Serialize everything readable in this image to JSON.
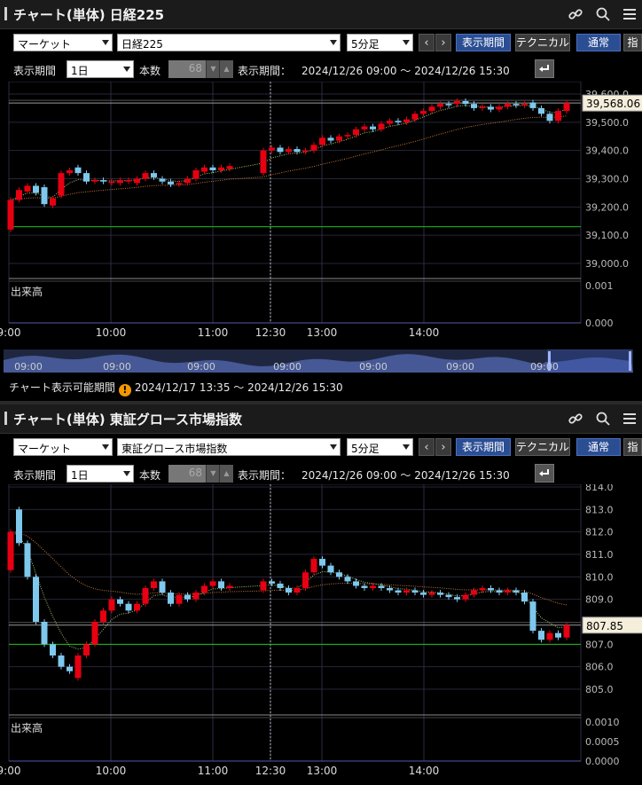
{
  "panels": [
    {
      "title": "チャート(単体) 日経225",
      "market": "マーケット",
      "symbol": "日経225",
      "interval": "5分足",
      "prev_label": "‹",
      "next_label": "›",
      "display_period_btn": "表示期間",
      "technical_btn": "テクニカル",
      "normal_btn": "通常",
      "extra_btn": "指",
      "period_label": "表示期間",
      "period_value": "1日",
      "count_label": "本数",
      "count_value": "68",
      "range_label": "表示期間：",
      "range_value": "2024/12/26 09:00 ～ 2024/12/26 15:30",
      "volume_label": "出来高",
      "current_price": "39,568.06",
      "price_ticks": [
        "39,600.0",
        "39,500.0",
        "39,400.0",
        "39,300.0",
        "39,200.0",
        "39,100.0",
        "39,000.0"
      ],
      "volume_ticks": [
        "0.001",
        "0.000"
      ],
      "time_ticks": [
        "9:00",
        "10:00",
        "11:00",
        "12:30",
        "13:00",
        "14:00"
      ],
      "navigator_ticks": [
        "09:00",
        "09:00",
        "09:00",
        "09:00",
        "09:00",
        "09:00",
        "09:00"
      ],
      "available_label": "チャート表示可能期間",
      "available_value": "2024/12/17 13:35 ～ 2024/12/26 15:30"
    },
    {
      "title": "チャート(単体) 東証グロース市場指数",
      "market": "マーケット",
      "symbol": "東証グロース市場指数",
      "interval": "5分足",
      "prev_label": "‹",
      "next_label": "›",
      "display_period_btn": "表示期間",
      "technical_btn": "テクニカル",
      "normal_btn": "通常",
      "extra_btn": "指",
      "period_label": "表示期間",
      "period_value": "1日",
      "count_label": "本数",
      "count_value": "68",
      "range_label": "表示期間：",
      "range_value": "2024/12/26 09:00 ～ 2024/12/26 15:30",
      "volume_label": "出来高",
      "current_price": "807.85",
      "price_ticks": [
        "814.0",
        "813.0",
        "812.0",
        "811.0",
        "810.0",
        "809.0",
        "807.0",
        "806.0",
        "805.0"
      ],
      "volume_ticks": [
        "0.0010",
        "0.0005",
        "0.0000"
      ],
      "time_ticks": [
        "9:00",
        "10:00",
        "11:00",
        "12:30",
        "13:00",
        "14:00"
      ]
    }
  ],
  "colors": {
    "up": "#e60012",
    "down": "#7ec8ee",
    "ma_short": "#a8c86a",
    "ma_long": "#c8783c",
    "support_line": "#19c219",
    "accent": "#2b4e93"
  },
  "chart_data": [
    {
      "type": "candlestick",
      "title": "日経225",
      "x_range": [
        "09:00",
        "15:30"
      ],
      "ylim": [
        39000,
        39600
      ],
      "candles": [
        {
          "t": "09:00",
          "o": 39120,
          "c": 39225
        },
        {
          "t": "09:05",
          "o": 39225,
          "c": 39260
        },
        {
          "t": "09:10",
          "o": 39255,
          "c": 39275
        },
        {
          "t": "09:15",
          "o": 39275,
          "c": 39250
        },
        {
          "t": "09:20",
          "o": 39270,
          "c": 39210
        },
        {
          "t": "09:25",
          "o": 39205,
          "c": 39230
        },
        {
          "t": "09:30",
          "o": 39240,
          "c": 39320
        },
        {
          "t": "09:35",
          "o": 39320,
          "c": 39330
        },
        {
          "t": "09:40",
          "o": 39340,
          "c": 39320
        },
        {
          "t": "09:45",
          "o": 39320,
          "c": 39290
        },
        {
          "t": "09:50",
          "o": 39290,
          "c": 39295
        },
        {
          "t": "09:55",
          "o": 39295,
          "c": 39290
        },
        {
          "t": "10:00",
          "o": 39285,
          "c": 39290
        },
        {
          "t": "10:05",
          "o": 39285,
          "c": 39295
        },
        {
          "t": "10:10",
          "o": 39290,
          "c": 39295
        },
        {
          "t": "10:15",
          "o": 39285,
          "c": 39300
        },
        {
          "t": "10:20",
          "o": 39300,
          "c": 39320
        },
        {
          "t": "10:25",
          "o": 39320,
          "c": 39305
        },
        {
          "t": "10:30",
          "o": 39300,
          "c": 39290
        },
        {
          "t": "10:35",
          "o": 39290,
          "c": 39280
        },
        {
          "t": "10:40",
          "o": 39280,
          "c": 39285
        },
        {
          "t": "10:45",
          "o": 39285,
          "c": 39300
        },
        {
          "t": "10:50",
          "o": 39300,
          "c": 39330
        },
        {
          "t": "10:55",
          "o": 39325,
          "c": 39340
        },
        {
          "t": "11:00",
          "o": 39340,
          "c": 39330
        },
        {
          "t": "11:05",
          "o": 39330,
          "c": 39340
        },
        {
          "t": "11:10",
          "o": 39335,
          "c": 39345
        },
        {
          "t": "12:30",
          "o": 39320,
          "c": 39400
        },
        {
          "t": "12:35",
          "o": 39400,
          "c": 39410
        },
        {
          "t": "12:40",
          "o": 39410,
          "c": 39395
        },
        {
          "t": "12:45",
          "o": 39395,
          "c": 39405
        },
        {
          "t": "12:50",
          "o": 39405,
          "c": 39395
        },
        {
          "t": "12:55",
          "o": 39395,
          "c": 39400
        },
        {
          "t": "13:00",
          "o": 39400,
          "c": 39420
        },
        {
          "t": "13:05",
          "o": 39420,
          "c": 39445
        },
        {
          "t": "13:10",
          "o": 39445,
          "c": 39435
        },
        {
          "t": "13:15",
          "o": 39435,
          "c": 39450
        },
        {
          "t": "13:20",
          "o": 39450,
          "c": 39455
        },
        {
          "t": "13:25",
          "o": 39455,
          "c": 39475
        },
        {
          "t": "13:30",
          "o": 39475,
          "c": 39485
        },
        {
          "t": "13:35",
          "o": 39485,
          "c": 39475
        },
        {
          "t": "13:40",
          "o": 39475,
          "c": 39495
        },
        {
          "t": "13:45",
          "o": 39495,
          "c": 39505
        },
        {
          "t": "13:50",
          "o": 39505,
          "c": 39500
        },
        {
          "t": "13:55",
          "o": 39500,
          "c": 39510
        },
        {
          "t": "14:00",
          "o": 39510,
          "c": 39530
        },
        {
          "t": "14:05",
          "o": 39530,
          "c": 39540
        },
        {
          "t": "14:10",
          "o": 39540,
          "c": 39555
        },
        {
          "t": "14:15",
          "o": 39555,
          "c": 39565
        },
        {
          "t": "14:20",
          "o": 39565,
          "c": 39560
        },
        {
          "t": "14:25",
          "o": 39565,
          "c": 39575
        },
        {
          "t": "14:30",
          "o": 39575,
          "c": 39565
        },
        {
          "t": "14:35",
          "o": 39565,
          "c": 39550
        },
        {
          "t": "14:40",
          "o": 39550,
          "c": 39555
        },
        {
          "t": "14:45",
          "o": 39555,
          "c": 39545
        },
        {
          "t": "14:50",
          "o": 39545,
          "c": 39555
        },
        {
          "t": "14:55",
          "o": 39555,
          "c": 39565
        },
        {
          "t": "15:00",
          "o": 39565,
          "c": 39560
        },
        {
          "t": "15:05",
          "o": 39560,
          "c": 39565
        },
        {
          "t": "15:10",
          "o": 39570,
          "c": 39550
        },
        {
          "t": "15:15",
          "o": 39550,
          "c": 39530
        },
        {
          "t": "15:20",
          "o": 39530,
          "c": 39505
        },
        {
          "t": "15:25",
          "o": 39505,
          "c": 39540
        },
        {
          "t": "15:30",
          "o": 39540,
          "c": 39568
        }
      ],
      "support_line": 39130
    },
    {
      "type": "candlestick",
      "title": "東証グロース市場指数",
      "x_range": [
        "09:00",
        "15:30"
      ],
      "ylim": [
        804.5,
        814.0
      ],
      "candles": [
        {
          "t": "09:00",
          "o": 810.3,
          "c": 812.0
        },
        {
          "t": "09:05",
          "o": 813.0,
          "c": 811.5
        },
        {
          "t": "09:10",
          "o": 811.5,
          "c": 810.0
        },
        {
          "t": "09:15",
          "o": 810.0,
          "c": 808.0
        },
        {
          "t": "09:20",
          "o": 808.0,
          "c": 807.0
        },
        {
          "t": "09:25",
          "o": 807.0,
          "c": 806.5
        },
        {
          "t": "09:30",
          "o": 806.5,
          "c": 806.0
        },
        {
          "t": "09:35",
          "o": 806.0,
          "c": 805.8
        },
        {
          "t": "09:40",
          "o": 805.5,
          "c": 806.5
        },
        {
          "t": "09:45",
          "o": 806.5,
          "c": 807.0
        },
        {
          "t": "09:50",
          "o": 807.0,
          "c": 808.0
        },
        {
          "t": "09:55",
          "o": 808.0,
          "c": 808.5
        },
        {
          "t": "10:00",
          "o": 808.5,
          "c": 809.0
        },
        {
          "t": "10:05",
          "o": 809.0,
          "c": 808.8
        },
        {
          "t": "10:10",
          "o": 808.8,
          "c": 808.5
        },
        {
          "t": "10:15",
          "o": 808.5,
          "c": 808.8
        },
        {
          "t": "10:20",
          "o": 808.8,
          "c": 809.5
        },
        {
          "t": "10:25",
          "o": 809.5,
          "c": 809.8
        },
        {
          "t": "10:30",
          "o": 809.8,
          "c": 809.3
        },
        {
          "t": "10:35",
          "o": 809.3,
          "c": 808.8
        },
        {
          "t": "10:40",
          "o": 808.8,
          "c": 809.2
        },
        {
          "t": "10:45",
          "o": 809.2,
          "c": 809.0
        },
        {
          "t": "10:50",
          "o": 809.0,
          "c": 809.3
        },
        {
          "t": "10:55",
          "o": 809.3,
          "c": 809.6
        },
        {
          "t": "11:00",
          "o": 809.6,
          "c": 809.8
        },
        {
          "t": "11:05",
          "o": 809.8,
          "c": 809.5
        },
        {
          "t": "11:10",
          "o": 809.5,
          "c": 809.6
        },
        {
          "t": "12:30",
          "o": 809.4,
          "c": 809.8
        },
        {
          "t": "12:35",
          "o": 809.8,
          "c": 809.7
        },
        {
          "t": "12:40",
          "o": 809.7,
          "c": 809.5
        },
        {
          "t": "12:45",
          "o": 809.5,
          "c": 809.3
        },
        {
          "t": "12:50",
          "o": 809.3,
          "c": 809.5
        },
        {
          "t": "12:55",
          "o": 809.5,
          "c": 810.2
        },
        {
          "t": "13:00",
          "o": 810.2,
          "c": 810.8
        },
        {
          "t": "13:05",
          "o": 810.8,
          "c": 810.5
        },
        {
          "t": "13:10",
          "o": 810.5,
          "c": 810.2
        },
        {
          "t": "13:15",
          "o": 810.2,
          "c": 810.0
        },
        {
          "t": "13:20",
          "o": 810.0,
          "c": 809.8
        },
        {
          "t": "13:25",
          "o": 809.8,
          "c": 809.6
        },
        {
          "t": "13:30",
          "o": 809.6,
          "c": 809.5
        },
        {
          "t": "13:35",
          "o": 809.5,
          "c": 809.6
        },
        {
          "t": "13:40",
          "o": 809.6,
          "c": 809.5
        },
        {
          "t": "13:45",
          "o": 809.5,
          "c": 809.4
        },
        {
          "t": "13:50",
          "o": 809.4,
          "c": 809.3
        },
        {
          "t": "13:55",
          "o": 809.3,
          "c": 809.4
        },
        {
          "t": "14:00",
          "o": 809.4,
          "c": 809.3
        },
        {
          "t": "14:05",
          "o": 809.3,
          "c": 809.2
        },
        {
          "t": "14:10",
          "o": 809.2,
          "c": 809.3
        },
        {
          "t": "14:15",
          "o": 809.3,
          "c": 809.2
        },
        {
          "t": "14:20",
          "o": 809.2,
          "c": 809.1
        },
        {
          "t": "14:25",
          "o": 809.1,
          "c": 809.0
        },
        {
          "t": "14:30",
          "o": 809.0,
          "c": 809.2
        },
        {
          "t": "14:35",
          "o": 809.2,
          "c": 809.4
        },
        {
          "t": "14:40",
          "o": 809.4,
          "c": 809.5
        },
        {
          "t": "14:45",
          "o": 809.5,
          "c": 809.4
        },
        {
          "t": "14:50",
          "o": 809.4,
          "c": 809.3
        },
        {
          "t": "14:55",
          "o": 809.3,
          "c": 809.4
        },
        {
          "t": "15:00",
          "o": 809.4,
          "c": 809.3
        },
        {
          "t": "15:05",
          "o": 809.3,
          "c": 808.9
        },
        {
          "t": "15:10",
          "o": 808.9,
          "c": 807.6
        },
        {
          "t": "15:15",
          "o": 807.6,
          "c": 807.2
        },
        {
          "t": "15:20",
          "o": 807.2,
          "c": 807.5
        },
        {
          "t": "15:25",
          "o": 807.5,
          "c": 807.3
        },
        {
          "t": "15:30",
          "o": 807.3,
          "c": 807.85
        }
      ],
      "support_line": 807.0
    }
  ]
}
